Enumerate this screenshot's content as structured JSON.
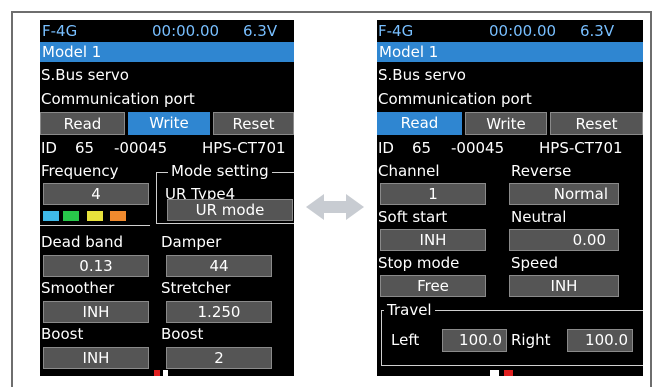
{
  "left_screen": {
    "status": {
      "system": "F-4G",
      "timer": "00:00.00",
      "voltage": "6.3V"
    },
    "model": "Model 1",
    "title1": "S.Bus servo",
    "title2": "Communication port",
    "buttons": {
      "read": "Read",
      "write": "Write",
      "reset": "Reset",
      "active": "write"
    },
    "id_row": {
      "id_label": "ID",
      "id_num": "65",
      "id_code": "-00045",
      "servo": "HPS-CT701"
    },
    "frequency": {
      "label": "Frequency",
      "value": "4"
    },
    "mode_setting": {
      "title": "Mode setting",
      "type": "UR Type4",
      "value": "UR mode"
    },
    "swatch_colors": [
      "#3fb9e8",
      "#28c84a",
      "#e8e23c",
      "#f08a2e"
    ],
    "dead_band": {
      "label": "Dead band",
      "value": "0.13"
    },
    "damper": {
      "label": "Damper",
      "value": "44"
    },
    "smoother": {
      "label": "Smoother",
      "value": "INH"
    },
    "stretcher": {
      "label": "Stretcher",
      "value": "1.250"
    },
    "boost_left": {
      "label": "Boost",
      "value": "INH"
    },
    "boost_right": {
      "label": "Boost",
      "value": "2"
    }
  },
  "right_screen": {
    "status": {
      "system": "F-4G",
      "timer": "00:00.00",
      "voltage": "6.3V"
    },
    "model": "Model 1",
    "title1": "S.Bus servo",
    "title2": "Communication port",
    "buttons": {
      "read": "Read",
      "write": "Write",
      "reset": "Reset",
      "active": "read"
    },
    "id_row": {
      "id_label": "ID",
      "id_num": "65",
      "id_code": "-00045",
      "servo": "HPS-CT701"
    },
    "channel": {
      "label": "Channel",
      "value": "1"
    },
    "reverse": {
      "label": "Reverse",
      "value": "Normal"
    },
    "soft_start": {
      "label": "Soft start",
      "value": "INH"
    },
    "neutral": {
      "label": "Neutral",
      "value": "0.00"
    },
    "stop_mode": {
      "label": "Stop mode",
      "value": "Free"
    },
    "speed": {
      "label": "Speed",
      "value": "INH"
    },
    "travel": {
      "title": "Travel",
      "left_label": "Left",
      "left_value": "100.0",
      "right_label": "Right",
      "right_value": "100.0"
    }
  },
  "colors": {
    "status_text": "#78bfff",
    "model_bar": "#2f86d1",
    "value_box": "#555555",
    "arrow": "#c8ccd2",
    "frame": "#6e6e6e"
  },
  "icons": {
    "between_screens": "double-arrow-icon"
  }
}
